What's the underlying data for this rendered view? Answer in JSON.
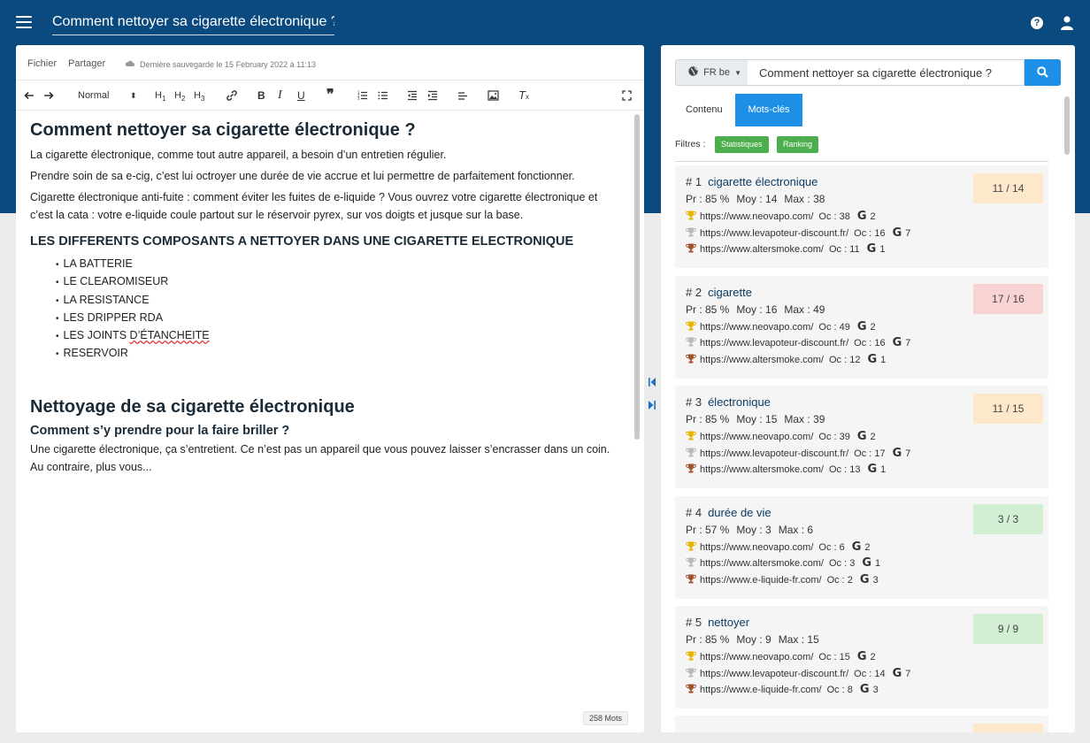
{
  "header": {
    "title": "Comment nettoyer sa cigarette électronique ?",
    "help_icon": "question-circle-icon",
    "user_icon": "user-icon",
    "menu_icon": "hamburger-icon"
  },
  "editor": {
    "menu": {
      "file": "Fichier",
      "share": "Partager"
    },
    "save_status": "Dernière sauvegarde le 15 February 2022 à 11:13",
    "format_select": "Normal",
    "heading_buttons": [
      "H1",
      "H2",
      "H3"
    ],
    "word_count": "258 Mots",
    "content": {
      "h1": "Comment nettoyer sa cigarette électronique ?",
      "p1": "La cigarette électronique, comme tout autre appareil, a besoin d’un entretien régulier.",
      "p2": "Prendre soin de sa e-cig, c’est lui octroyer une durée de vie accrue et lui permettre de parfaitement fonctionner.",
      "p3": "Cigarette électronique anti-fuite : comment éviter les fuites de e-liquide ? Vous ouvrez votre cigarette électronique et c’est la cata : votre e-liquide coule partout sur le réservoir pyrex, sur vos doigts et jusque sur la base.",
      "h2": "LES DIFFERENTS COMPOSANTS A NETTOYER DANS UNE CIGARETTE ELECTRONIQUE",
      "list": [
        "LA BATTERIE",
        "LE CLEAROMISEUR",
        "LA RESISTANCE",
        "LES DRIPPER RDA",
        "LES JOINTS",
        "D’ÉTANCHEITE",
        "RESERVOIR"
      ],
      "h1b": "Nettoyage de sa cigarette électronique",
      "h3": "Comment s’y prendre pour la faire briller ?",
      "p4": "Une cigarette électronique, ça s’entretient. Ce n’est pas un appareil que vous pouvez laisser s’encrasser dans un coin. Au contraire, plus vous..."
    }
  },
  "panel": {
    "lang": "FR be",
    "search_value": "Comment nettoyer sa cigarette électronique ?",
    "tabs": [
      "Contenu",
      "Mots-clés"
    ],
    "active_tab": "Mots-clés",
    "filters_label": "Filtres :",
    "filters": [
      "Statistiques",
      "Ranking"
    ],
    "colors": {
      "orange": "#fde8cc",
      "red": "#f8d3d3",
      "green": "#d3efd3",
      "accent": "#1e8fe6",
      "gold": "#e8b400",
      "silver": "#b9b9b9",
      "bronze": "#a0522d"
    },
    "keywords": [
      {
        "rank": "# 1",
        "term": "cigarette électronique",
        "pr": "Pr : 85 %",
        "moy": "Moy : 14",
        "max": "Max : 38",
        "score": "11 / 14",
        "color": "#fde8cc",
        "urls": [
          {
            "url": "https://www.neovapo.com/",
            "oc": "Oc : 38",
            "g": "2"
          },
          {
            "url": "https://www.levapoteur-discount.fr/",
            "oc": "Oc : 16",
            "g": "7"
          },
          {
            "url": "https://www.altersmoke.com/",
            "oc": "Oc : 11",
            "g": "1"
          }
        ]
      },
      {
        "rank": "# 2",
        "term": "cigarette",
        "pr": "Pr : 85 %",
        "moy": "Moy : 16",
        "max": "Max : 49",
        "score": "17 / 16",
        "color": "#f8d3d3",
        "urls": [
          {
            "url": "https://www.neovapo.com/",
            "oc": "Oc : 49",
            "g": "2"
          },
          {
            "url": "https://www.levapoteur-discount.fr/",
            "oc": "Oc : 16",
            "g": "7"
          },
          {
            "url": "https://www.altersmoke.com/",
            "oc": "Oc : 12",
            "g": "1"
          }
        ]
      },
      {
        "rank": "# 3",
        "term": "électronique",
        "pr": "Pr : 85 %",
        "moy": "Moy : 15",
        "max": "Max : 39",
        "score": "11 / 15",
        "color": "#fde8cc",
        "urls": [
          {
            "url": "https://www.neovapo.com/",
            "oc": "Oc : 39",
            "g": "2"
          },
          {
            "url": "https://www.levapoteur-discount.fr/",
            "oc": "Oc : 17",
            "g": "7"
          },
          {
            "url": "https://www.altersmoke.com/",
            "oc": "Oc : 13",
            "g": "1"
          }
        ]
      },
      {
        "rank": "# 4",
        "term": "durée de vie",
        "pr": "Pr : 57 %",
        "moy": "Moy : 3",
        "max": "Max : 6",
        "score": "3 / 3",
        "color": "#d3efd3",
        "urls": [
          {
            "url": "https://www.neovapo.com/",
            "oc": "Oc : 6",
            "g": "2"
          },
          {
            "url": "https://www.altersmoke.com/",
            "oc": "Oc : 3",
            "g": "1"
          },
          {
            "url": "https://www.e-liquide-fr.com/",
            "oc": "Oc : 2",
            "g": "3"
          }
        ]
      },
      {
        "rank": "# 5",
        "term": "nettoyer",
        "pr": "Pr : 85 %",
        "moy": "Moy : 9",
        "max": "Max : 15",
        "score": "9 / 9",
        "color": "#d3efd3",
        "urls": [
          {
            "url": "https://www.neovapo.com/",
            "oc": "Oc : 15",
            "g": "2"
          },
          {
            "url": "https://www.levapoteur-discount.fr/",
            "oc": "Oc : 14",
            "g": "7"
          },
          {
            "url": "https://www.e-liquide-fr.com/",
            "oc": "Oc : 8",
            "g": "3"
          }
        ]
      }
    ]
  }
}
